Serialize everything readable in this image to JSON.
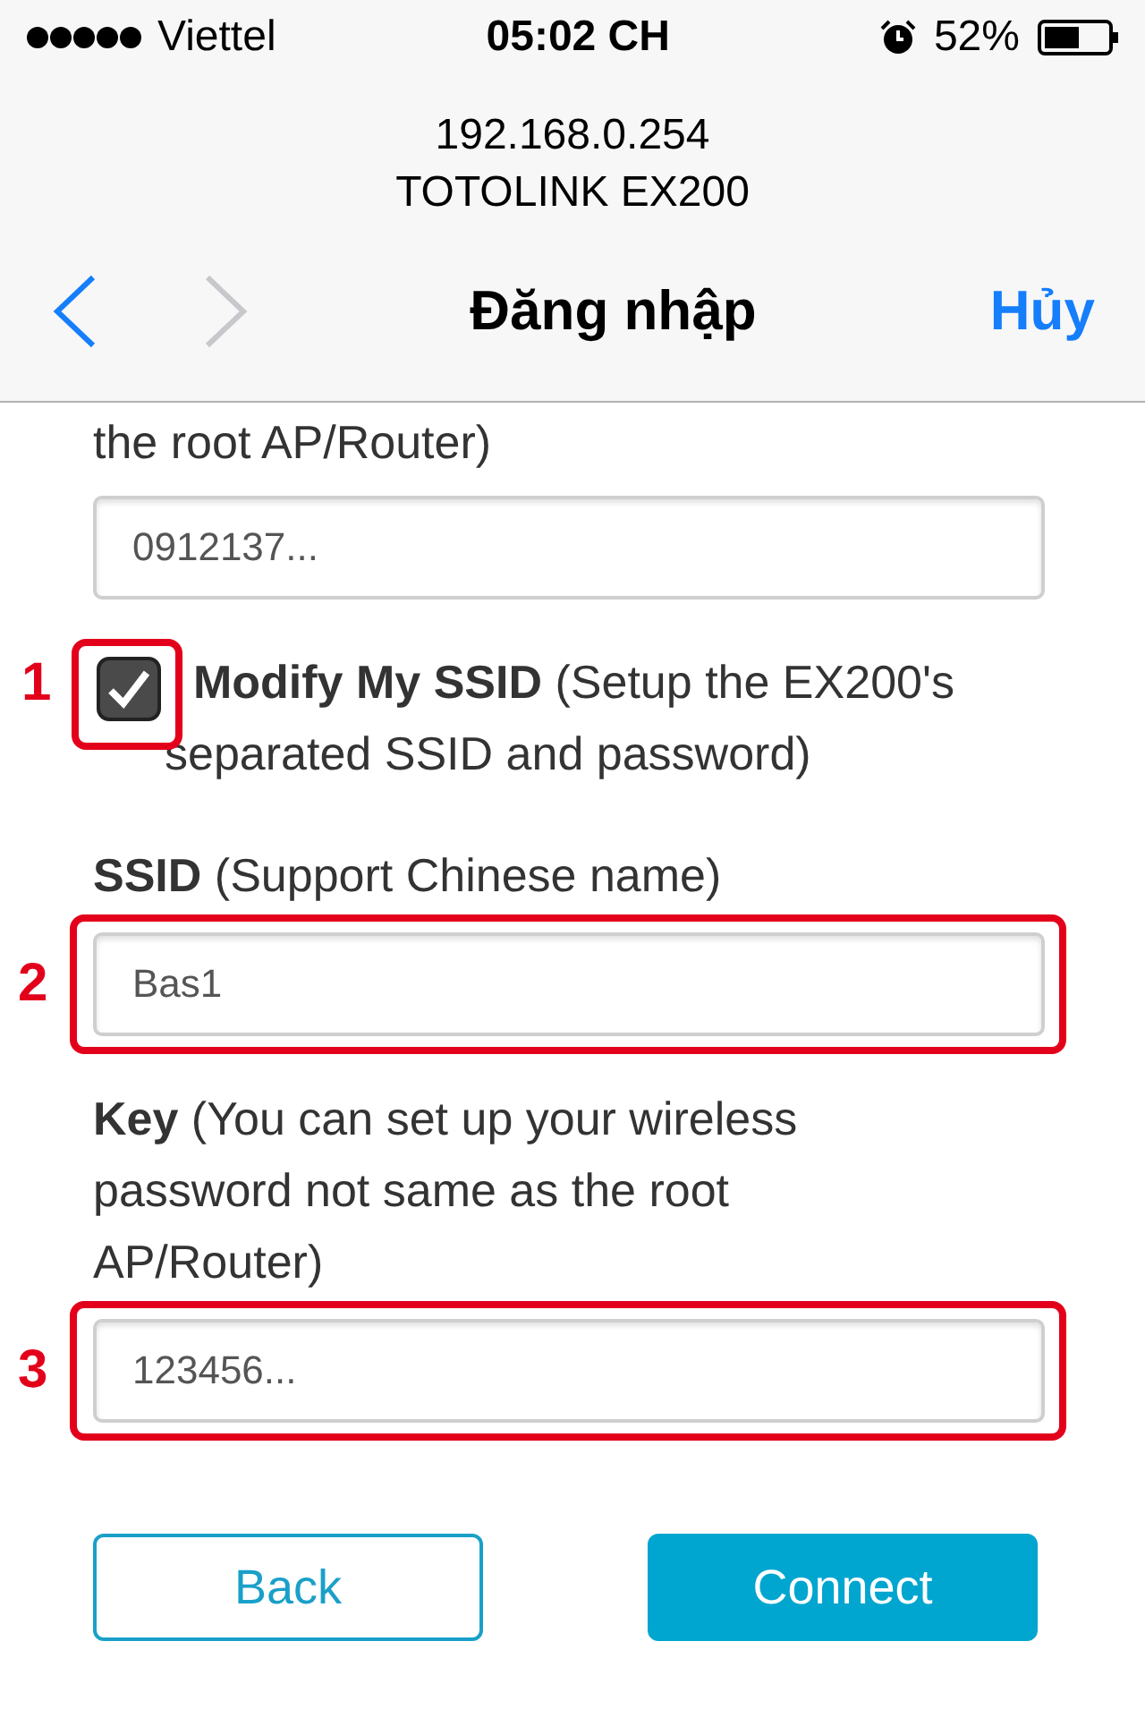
{
  "status_bar": {
    "carrier": "Viettel",
    "time": "05:02 CH",
    "battery": "52%"
  },
  "browser": {
    "url": "192.168.0.254",
    "page_title": "TOTOLINK EX200",
    "back_enabled": true,
    "forward_enabled": false,
    "title": "Đăng nhập",
    "cancel": "Hủy"
  },
  "form": {
    "cut_text": "the root AP/Router)",
    "fields": [
      {
        "kind": "input",
        "value": "0912137..."
      },
      {
        "kind": "checkbox",
        "label": "**Modify My SSID** (Setup the EX200's separated SSID and password)",
        "checked": true,
        "annotation": "1"
      },
      {
        "kind": "label",
        "label": "**SSID** (Support Chinese name)"
      },
      {
        "kind": "input",
        "value": "Bas1",
        "annotation": "2"
      },
      {
        "kind": "label",
        "label": "**Key** (You can set up your wireless password not same as the root AP/Router)"
      },
      {
        "kind": "input",
        "value": "123456...",
        "annotation": "3"
      }
    ],
    "buttons": [
      {
        "label": "Back",
        "kind": "secondary"
      },
      {
        "label": "Connect",
        "kind": "primary"
      }
    ]
  }
}
